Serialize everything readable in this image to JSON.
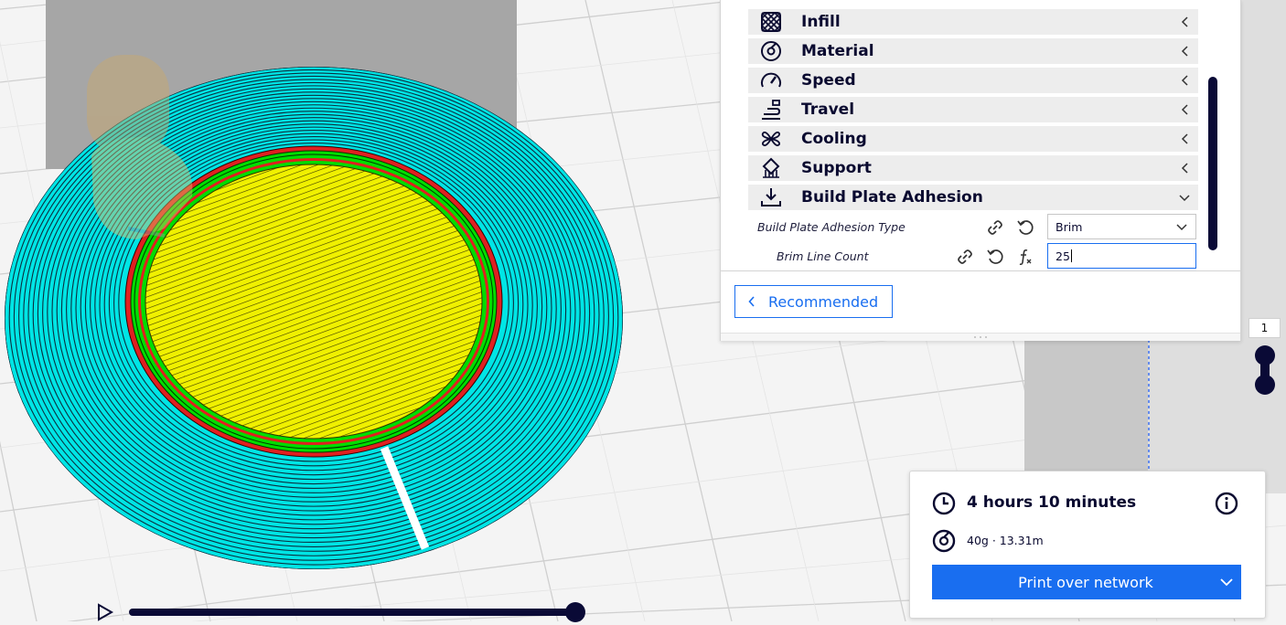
{
  "settings": {
    "categories": [
      {
        "label": "Infill",
        "icon": "infill-icon",
        "expanded": false
      },
      {
        "label": "Material",
        "icon": "material-spool-icon",
        "expanded": false
      },
      {
        "label": "Speed",
        "icon": "speedometer-icon",
        "expanded": false
      },
      {
        "label": "Travel",
        "icon": "travel-icon",
        "expanded": false
      },
      {
        "label": "Cooling",
        "icon": "fan-icon",
        "expanded": false
      },
      {
        "label": "Support",
        "icon": "support-icon",
        "expanded": false
      },
      {
        "label": "Build Plate Adhesion",
        "icon": "build-plate-adhesion-icon",
        "expanded": true
      }
    ],
    "adhesion_type": {
      "label": "Build Plate Adhesion Type",
      "value": "Brim"
    },
    "brim_line_count": {
      "label": "Brim Line Count",
      "value": "25"
    },
    "recommended_label": "Recommended"
  },
  "layer_slider": {
    "current_layer": "1"
  },
  "print_info": {
    "time": "4 hours 10 minutes",
    "material": "40g · 13.31m",
    "print_button_label": "Print over network"
  },
  "colors": {
    "accent": "#196ef0",
    "dark": "#0a0a36",
    "brim": "#00e5e5",
    "skin": "#f0f000",
    "wall_outer": "#e02020",
    "wall_inner": "#00dd00"
  }
}
